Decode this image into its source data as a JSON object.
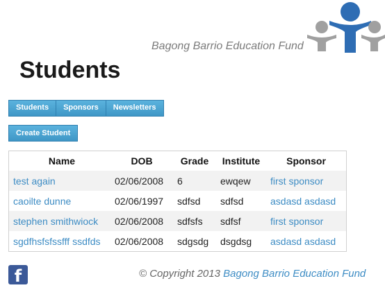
{
  "brand": {
    "name": "Bagong Barrio Education Fund"
  },
  "page": {
    "title": "Students"
  },
  "nav": {
    "items": [
      {
        "label": "Students"
      },
      {
        "label": "Sponsors"
      },
      {
        "label": "Newsletters"
      }
    ]
  },
  "actions": {
    "create_label": "Create Student"
  },
  "table": {
    "headers": [
      "Name",
      "DOB",
      "Grade",
      "Institute",
      "Sponsor"
    ],
    "rows": [
      {
        "name": "test again",
        "dob": "02/06/2008",
        "grade": "6",
        "institute": "ewqew",
        "sponsor": "first sponsor"
      },
      {
        "name": "caoilte dunne",
        "dob": "02/06/1997",
        "grade": "sdfsd",
        "institute": "sdfsd",
        "sponsor": "asdasd asdasd"
      },
      {
        "name": "stephen smithwiock",
        "dob": "02/06/2008",
        "grade": "sdfsfs",
        "institute": "sdfsf",
        "sponsor": "first sponsor"
      },
      {
        "name": "sgdfhsfsfssfff ssdfds",
        "dob": "02/06/2008",
        "grade": "sdgsdg",
        "institute": "dsgdsg",
        "sponsor": "asdasd asdasd"
      }
    ]
  },
  "footer": {
    "copyright": "© Copyright 2013",
    "link": "Bagong Barrio Education Fund"
  },
  "social": {
    "facebook_icon": "f"
  },
  "colors": {
    "accent": "#3d8cc4",
    "nav_bg": "#4aa3d1",
    "logo_blue": "#2e6db4",
    "logo_gray": "#a0a0a0",
    "facebook": "#3b5998"
  }
}
